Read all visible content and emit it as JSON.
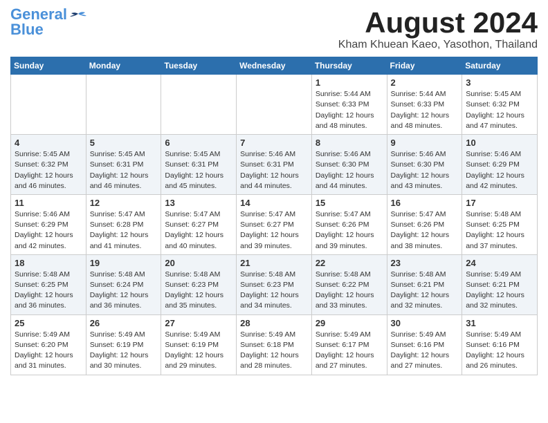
{
  "logo": {
    "general": "General",
    "blue": "Blue"
  },
  "title": "August 2024",
  "subtitle": "Kham Khuean Kaeo, Yasothon, Thailand",
  "days_of_week": [
    "Sunday",
    "Monday",
    "Tuesday",
    "Wednesday",
    "Thursday",
    "Friday",
    "Saturday"
  ],
  "weeks": [
    {
      "row_style": "row-normal",
      "days": [
        {
          "number": "",
          "info": "",
          "empty": true
        },
        {
          "number": "",
          "info": "",
          "empty": true
        },
        {
          "number": "",
          "info": "",
          "empty": true
        },
        {
          "number": "",
          "info": "",
          "empty": true
        },
        {
          "number": "1",
          "info": "Sunrise: 5:44 AM\nSunset: 6:33 PM\nDaylight: 12 hours\nand 48 minutes.",
          "empty": false
        },
        {
          "number": "2",
          "info": "Sunrise: 5:44 AM\nSunset: 6:33 PM\nDaylight: 12 hours\nand 48 minutes.",
          "empty": false
        },
        {
          "number": "3",
          "info": "Sunrise: 5:45 AM\nSunset: 6:32 PM\nDaylight: 12 hours\nand 47 minutes.",
          "empty": false
        }
      ]
    },
    {
      "row_style": "row-alt",
      "days": [
        {
          "number": "4",
          "info": "Sunrise: 5:45 AM\nSunset: 6:32 PM\nDaylight: 12 hours\nand 46 minutes.",
          "empty": false
        },
        {
          "number": "5",
          "info": "Sunrise: 5:45 AM\nSunset: 6:31 PM\nDaylight: 12 hours\nand 46 minutes.",
          "empty": false
        },
        {
          "number": "6",
          "info": "Sunrise: 5:45 AM\nSunset: 6:31 PM\nDaylight: 12 hours\nand 45 minutes.",
          "empty": false
        },
        {
          "number": "7",
          "info": "Sunrise: 5:46 AM\nSunset: 6:31 PM\nDaylight: 12 hours\nand 44 minutes.",
          "empty": false
        },
        {
          "number": "8",
          "info": "Sunrise: 5:46 AM\nSunset: 6:30 PM\nDaylight: 12 hours\nand 44 minutes.",
          "empty": false
        },
        {
          "number": "9",
          "info": "Sunrise: 5:46 AM\nSunset: 6:30 PM\nDaylight: 12 hours\nand 43 minutes.",
          "empty": false
        },
        {
          "number": "10",
          "info": "Sunrise: 5:46 AM\nSunset: 6:29 PM\nDaylight: 12 hours\nand 42 minutes.",
          "empty": false
        }
      ]
    },
    {
      "row_style": "row-normal",
      "days": [
        {
          "number": "11",
          "info": "Sunrise: 5:46 AM\nSunset: 6:29 PM\nDaylight: 12 hours\nand 42 minutes.",
          "empty": false
        },
        {
          "number": "12",
          "info": "Sunrise: 5:47 AM\nSunset: 6:28 PM\nDaylight: 12 hours\nand 41 minutes.",
          "empty": false
        },
        {
          "number": "13",
          "info": "Sunrise: 5:47 AM\nSunset: 6:27 PM\nDaylight: 12 hours\nand 40 minutes.",
          "empty": false
        },
        {
          "number": "14",
          "info": "Sunrise: 5:47 AM\nSunset: 6:27 PM\nDaylight: 12 hours\nand 39 minutes.",
          "empty": false
        },
        {
          "number": "15",
          "info": "Sunrise: 5:47 AM\nSunset: 6:26 PM\nDaylight: 12 hours\nand 39 minutes.",
          "empty": false
        },
        {
          "number": "16",
          "info": "Sunrise: 5:47 AM\nSunset: 6:26 PM\nDaylight: 12 hours\nand 38 minutes.",
          "empty": false
        },
        {
          "number": "17",
          "info": "Sunrise: 5:48 AM\nSunset: 6:25 PM\nDaylight: 12 hours\nand 37 minutes.",
          "empty": false
        }
      ]
    },
    {
      "row_style": "row-alt",
      "days": [
        {
          "number": "18",
          "info": "Sunrise: 5:48 AM\nSunset: 6:25 PM\nDaylight: 12 hours\nand 36 minutes.",
          "empty": false
        },
        {
          "number": "19",
          "info": "Sunrise: 5:48 AM\nSunset: 6:24 PM\nDaylight: 12 hours\nand 36 minutes.",
          "empty": false
        },
        {
          "number": "20",
          "info": "Sunrise: 5:48 AM\nSunset: 6:23 PM\nDaylight: 12 hours\nand 35 minutes.",
          "empty": false
        },
        {
          "number": "21",
          "info": "Sunrise: 5:48 AM\nSunset: 6:23 PM\nDaylight: 12 hours\nand 34 minutes.",
          "empty": false
        },
        {
          "number": "22",
          "info": "Sunrise: 5:48 AM\nSunset: 6:22 PM\nDaylight: 12 hours\nand 33 minutes.",
          "empty": false
        },
        {
          "number": "23",
          "info": "Sunrise: 5:48 AM\nSunset: 6:21 PM\nDaylight: 12 hours\nand 32 minutes.",
          "empty": false
        },
        {
          "number": "24",
          "info": "Sunrise: 5:49 AM\nSunset: 6:21 PM\nDaylight: 12 hours\nand 32 minutes.",
          "empty": false
        }
      ]
    },
    {
      "row_style": "row-normal",
      "days": [
        {
          "number": "25",
          "info": "Sunrise: 5:49 AM\nSunset: 6:20 PM\nDaylight: 12 hours\nand 31 minutes.",
          "empty": false
        },
        {
          "number": "26",
          "info": "Sunrise: 5:49 AM\nSunset: 6:19 PM\nDaylight: 12 hours\nand 30 minutes.",
          "empty": false
        },
        {
          "number": "27",
          "info": "Sunrise: 5:49 AM\nSunset: 6:19 PM\nDaylight: 12 hours\nand 29 minutes.",
          "empty": false
        },
        {
          "number": "28",
          "info": "Sunrise: 5:49 AM\nSunset: 6:18 PM\nDaylight: 12 hours\nand 28 minutes.",
          "empty": false
        },
        {
          "number": "29",
          "info": "Sunrise: 5:49 AM\nSunset: 6:17 PM\nDaylight: 12 hours\nand 27 minutes.",
          "empty": false
        },
        {
          "number": "30",
          "info": "Sunrise: 5:49 AM\nSunset: 6:16 PM\nDaylight: 12 hours\nand 27 minutes.",
          "empty": false
        },
        {
          "number": "31",
          "info": "Sunrise: 5:49 AM\nSunset: 6:16 PM\nDaylight: 12 hours\nand 26 minutes.",
          "empty": false
        }
      ]
    }
  ]
}
